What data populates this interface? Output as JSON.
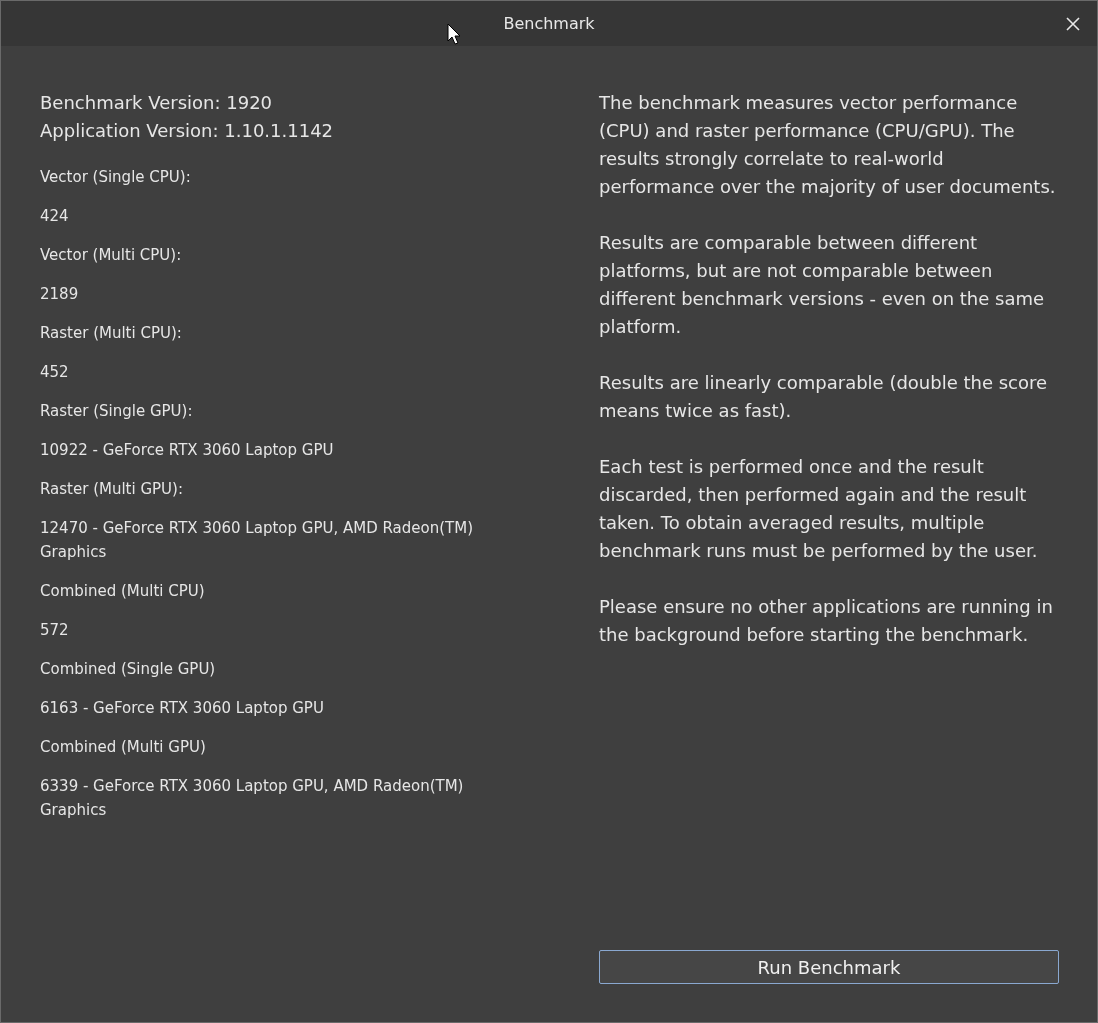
{
  "window": {
    "title": "Benchmark"
  },
  "header": [
    "Benchmark Version: 1920",
    "Application Version: 1.10.1.1142"
  ],
  "groups": [
    {
      "results": [
        {
          "label": "Vector (Single CPU):",
          "value": "424"
        },
        {
          "label": "Vector (Multi CPU):",
          "value": "2189"
        }
      ]
    },
    {
      "results": [
        {
          "label": "Raster (Multi CPU):",
          "value": "452"
        },
        {
          "label": "Raster (Single GPU):",
          "value": "10922 - GeForce RTX 3060 Laptop GPU"
        },
        {
          "label": "Raster (Multi GPU):",
          "value": "12470 - GeForce RTX 3060 Laptop GPU, AMD Radeon(TM) Graphics"
        }
      ]
    },
    {
      "results": [
        {
          "label": "Combined (Multi CPU)",
          "value": "572"
        },
        {
          "label": "Combined (Single GPU)",
          "value": "6163 - GeForce RTX 3060 Laptop GPU"
        },
        {
          "label": "Combined (Multi GPU)",
          "value": "6339 - GeForce RTX 3060 Laptop GPU, AMD Radeon(TM) Graphics"
        }
      ]
    }
  ],
  "description": [
    "The benchmark measures vector performance (CPU) and raster performance (CPU/GPU). The results strongly correlate to real-world performance over the majority of user documents.",
    "Results are comparable between different platforms, but are not comparable between different benchmark versions - even on the same platform.",
    "Results are linearly comparable (double the score means twice as fast).",
    "Each test is performed once and the result discarded, then performed again and the result taken. To obtain averaged results, multiple benchmark runs must be performed by the user.",
    "Please ensure no other applications are running in the background before starting the benchmark."
  ],
  "button": "Run Benchmark"
}
